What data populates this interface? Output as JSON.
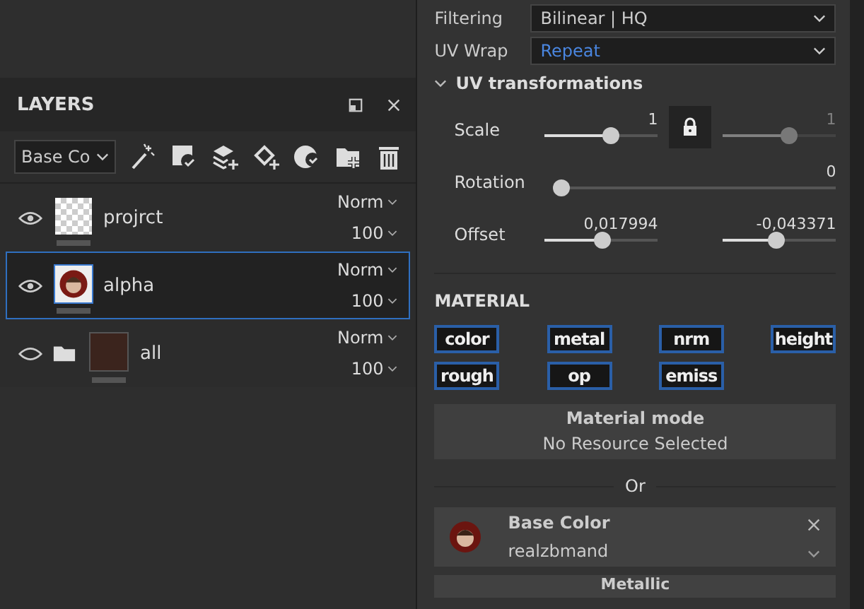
{
  "layers_panel": {
    "title": "LAYERS",
    "channel_select": "Base Co",
    "layers": [
      {
        "name": "projrct",
        "kind": "empty",
        "visible": true,
        "selected": false,
        "blend": "Norm",
        "opacity": "100"
      },
      {
        "name": "alpha",
        "kind": "image",
        "visible": true,
        "selected": true,
        "blend": "Norm",
        "opacity": "100"
      },
      {
        "name": "all",
        "kind": "folder",
        "visible": false,
        "selected": false,
        "blend": "Norm",
        "opacity": "100"
      }
    ]
  },
  "properties": {
    "filtering": {
      "label": "Filtering",
      "value": "Bilinear | HQ"
    },
    "uv_wrap": {
      "label": "UV Wrap",
      "value": "Repeat"
    },
    "uv_transformations": {
      "title": "UV transformations",
      "expanded": true,
      "scale": {
        "label": "Scale",
        "left": {
          "reading": "1",
          "level": 0.58
        },
        "right": {
          "reading": "1",
          "level": 0.58
        }
      },
      "rotation": {
        "label": "Rotation",
        "reading": "0",
        "level": 0
      },
      "offset": {
        "label": "Offset",
        "left": {
          "reading": "0,017994",
          "level": 0.51
        },
        "right": {
          "reading": "-0,043371",
          "level": 0.47
        }
      }
    },
    "material": {
      "title": "MATERIAL",
      "channels": [
        "color",
        "metal",
        "nrm",
        "height",
        "rough",
        "op",
        "emiss"
      ],
      "mode_title": "Material mode",
      "mode_value": "No Resource Selected",
      "or": "Or",
      "base_color": {
        "title": "Base Color",
        "value": "realzbmand"
      },
      "next_card": "Metallic"
    }
  }
}
